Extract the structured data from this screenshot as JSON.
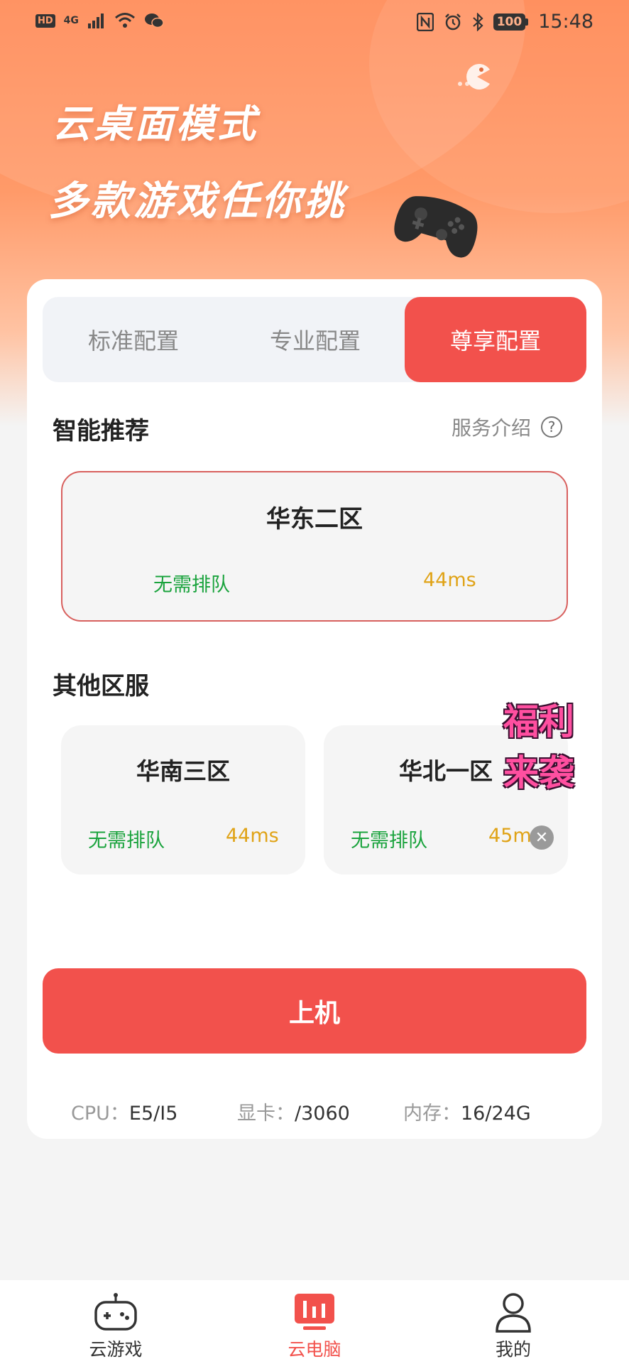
{
  "status_bar": {
    "network": "4G",
    "battery": "100",
    "time": "15:48"
  },
  "hero": {
    "title_line1": "云桌面模式",
    "title_line2": "多款游戏任你挑"
  },
  "config_tabs": [
    {
      "label": "标准配置",
      "selected": false
    },
    {
      "label": "专业配置",
      "selected": false
    },
    {
      "label": "尊享配置",
      "selected": true
    }
  ],
  "recommend": {
    "title": "智能推荐",
    "service_link": "服务介绍",
    "server": {
      "name": "华东二区",
      "queue": "无需排队",
      "ping": "44ms"
    }
  },
  "others": {
    "title": "其他区服",
    "servers": [
      {
        "name": "华南三区",
        "queue": "无需排队",
        "ping": "44ms"
      },
      {
        "name": "华北一区",
        "queue": "无需排队",
        "ping": "45ms"
      }
    ]
  },
  "promo": {
    "line1": "福利",
    "line2": "来袭"
  },
  "launch_button": "上机",
  "specs": {
    "cpu_label": "CPU：",
    "cpu_value": "E5/I5",
    "gpu_label": "显卡：",
    "gpu_value": "/3060",
    "ram_label": "内存：",
    "ram_value": "16/24G"
  },
  "bottom_nav": [
    {
      "label": "云游戏",
      "icon": "gamepad-icon",
      "active": false
    },
    {
      "label": "云电脑",
      "icon": "bar-chart-icon",
      "active": true
    },
    {
      "label": "我的",
      "icon": "user-icon",
      "active": false
    }
  ],
  "colors": {
    "accent": "#f2514c",
    "hero_orange": "#ff8752",
    "queue_green": "#1aa33d",
    "ping_yellow": "#e0a317"
  }
}
